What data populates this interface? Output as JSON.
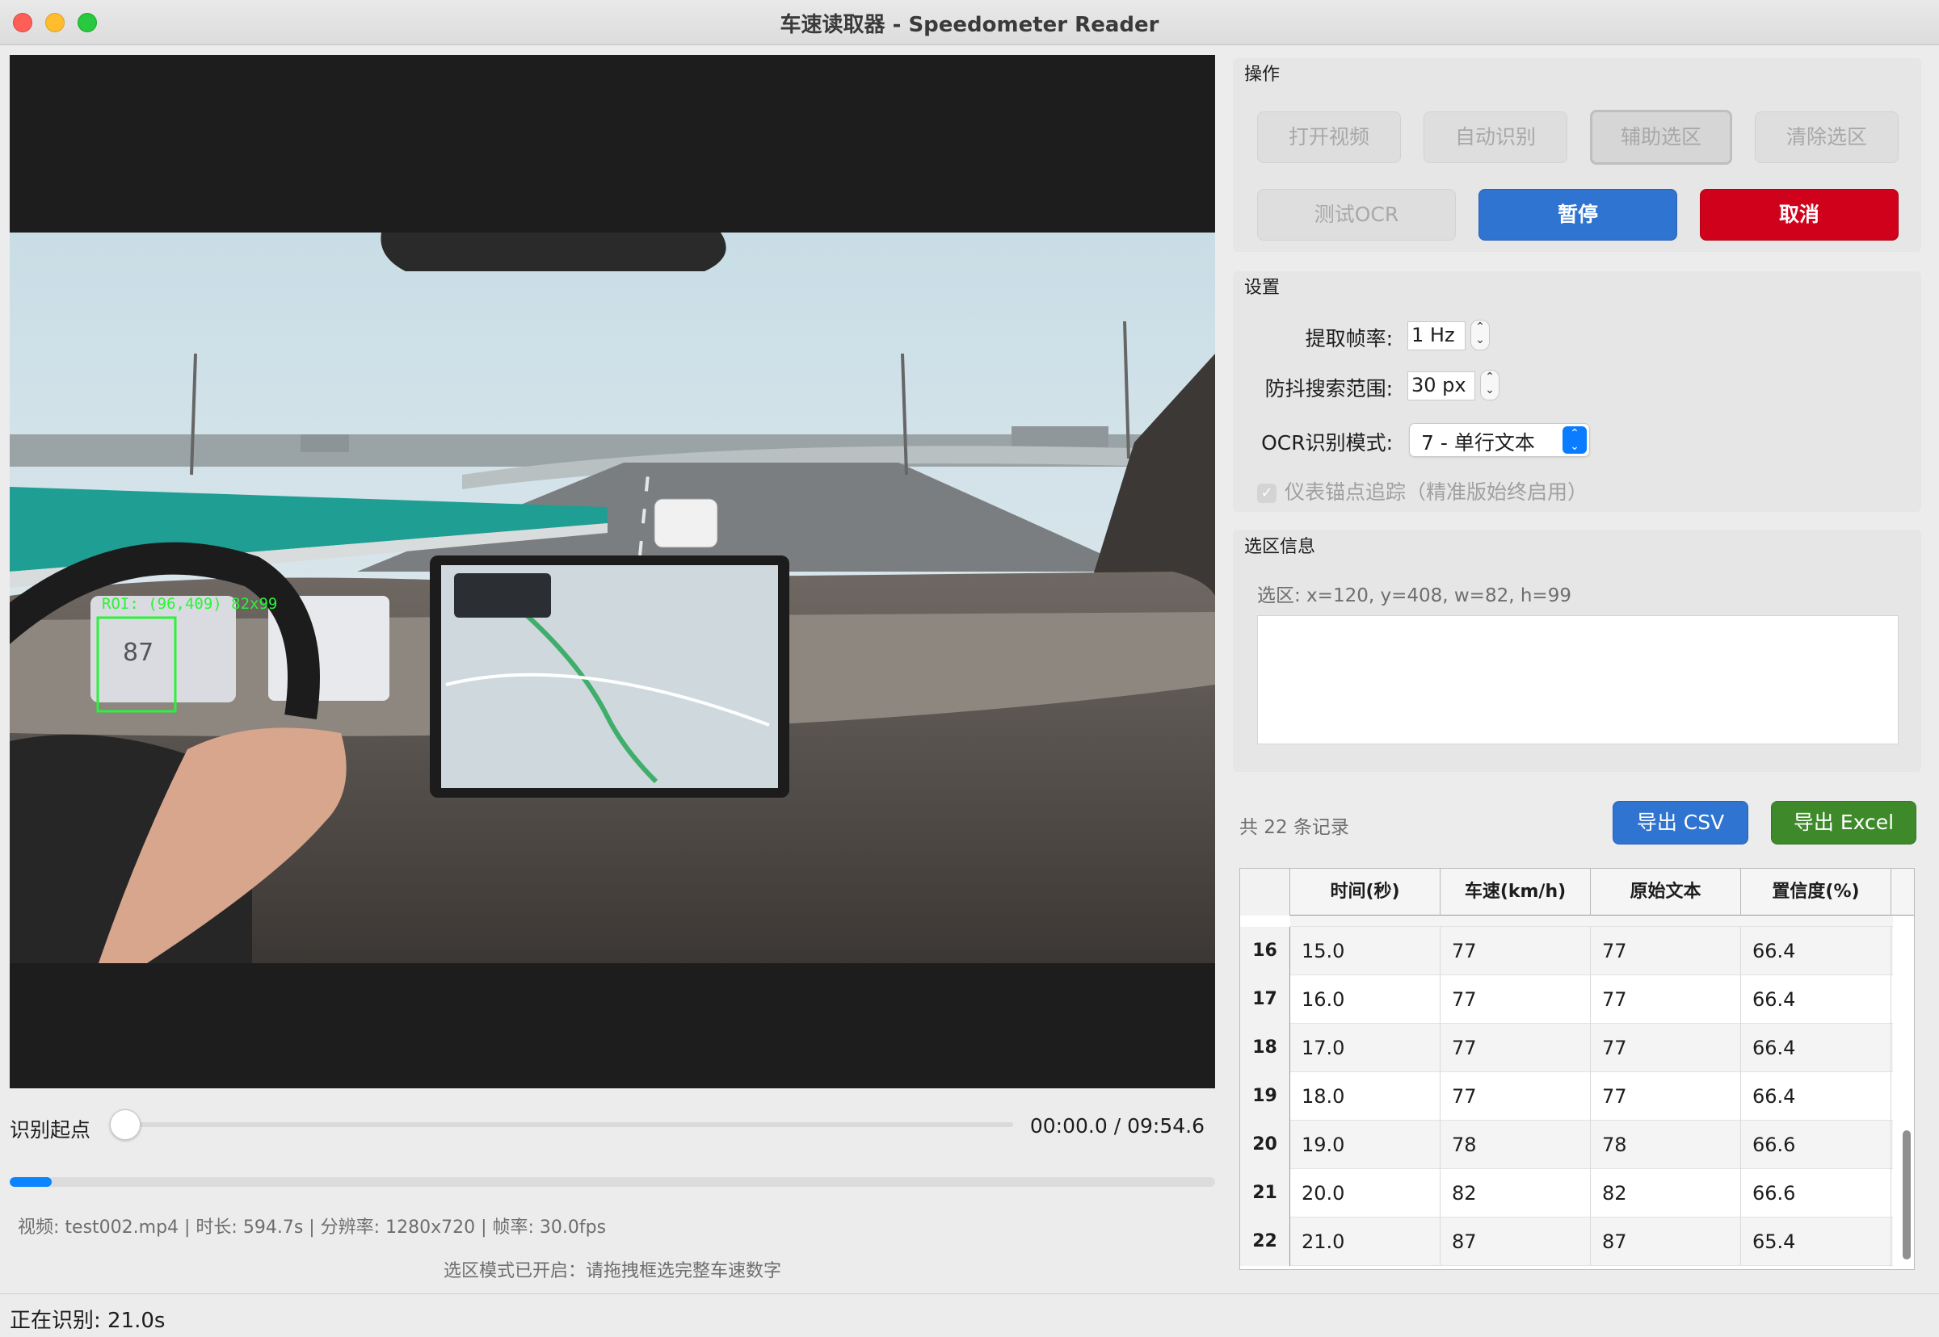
{
  "window": {
    "title": "车速读取器 - Speedometer Reader"
  },
  "video": {
    "roi_label": "ROI: (96,409) 82x99",
    "speed_digits": "87"
  },
  "slider": {
    "label": "识别起点",
    "timecode": "00:00.0 / 09:54.6",
    "position": 0.0
  },
  "progress": {
    "value": 0.035
  },
  "video_info": "视频: test002.mp4 | 时长: 594.7s | 分辨率: 1280x720 | 帧率: 30.0fps",
  "hint": "选区模式已开启：请拖拽框选完整车速数字",
  "status": "正在识别: 21.0s",
  "actions": {
    "title": "操作",
    "open_video": "打开视频",
    "auto_detect": "自动识别",
    "assist_select": "辅助选区",
    "clear_select": "清除选区",
    "test_ocr": "测试OCR",
    "pause": "暂停",
    "cancel": "取消"
  },
  "settings": {
    "title": "设置",
    "fps_label": "提取帧率:",
    "fps_value": "1 Hz",
    "range_label": "防抖搜索范围:",
    "range_value": "30 px",
    "ocr_label": "OCR识别模式:",
    "ocr_value": "7 - 单行文本",
    "anchor_checkbox": "仪表锚点追踪（精准版始终启用）",
    "anchor_checked": true
  },
  "selection": {
    "title": "选区信息",
    "text": "选区: x=120, y=408, w=82, h=99"
  },
  "records": {
    "count_text": "共 22 条记录",
    "export_csv": "导出 CSV",
    "export_excel": "导出 Excel",
    "columns": [
      "时间(秒)",
      "车速(km/h)",
      "原始文本",
      "置信度(%)"
    ],
    "rows": [
      {
        "idx": "16",
        "time": "15.0",
        "speed": "77",
        "raw": "77",
        "conf": "66.4"
      },
      {
        "idx": "17",
        "time": "16.0",
        "speed": "77",
        "raw": "77",
        "conf": "66.4"
      },
      {
        "idx": "18",
        "time": "17.0",
        "speed": "77",
        "raw": "77",
        "conf": "66.4"
      },
      {
        "idx": "19",
        "time": "18.0",
        "speed": "77",
        "raw": "77",
        "conf": "66.4"
      },
      {
        "idx": "20",
        "time": "19.0",
        "speed": "78",
        "raw": "78",
        "conf": "66.6"
      },
      {
        "idx": "21",
        "time": "20.0",
        "speed": "82",
        "raw": "82",
        "conf": "66.6"
      },
      {
        "idx": "22",
        "time": "21.0",
        "speed": "87",
        "raw": "87",
        "conf": "65.4"
      }
    ]
  },
  "colors": {
    "primary": "#2f74d0",
    "danger": "#d0021b",
    "excel": "#3e8a2a",
    "roi": "#2cf23a",
    "progress": "#0a84ff"
  }
}
